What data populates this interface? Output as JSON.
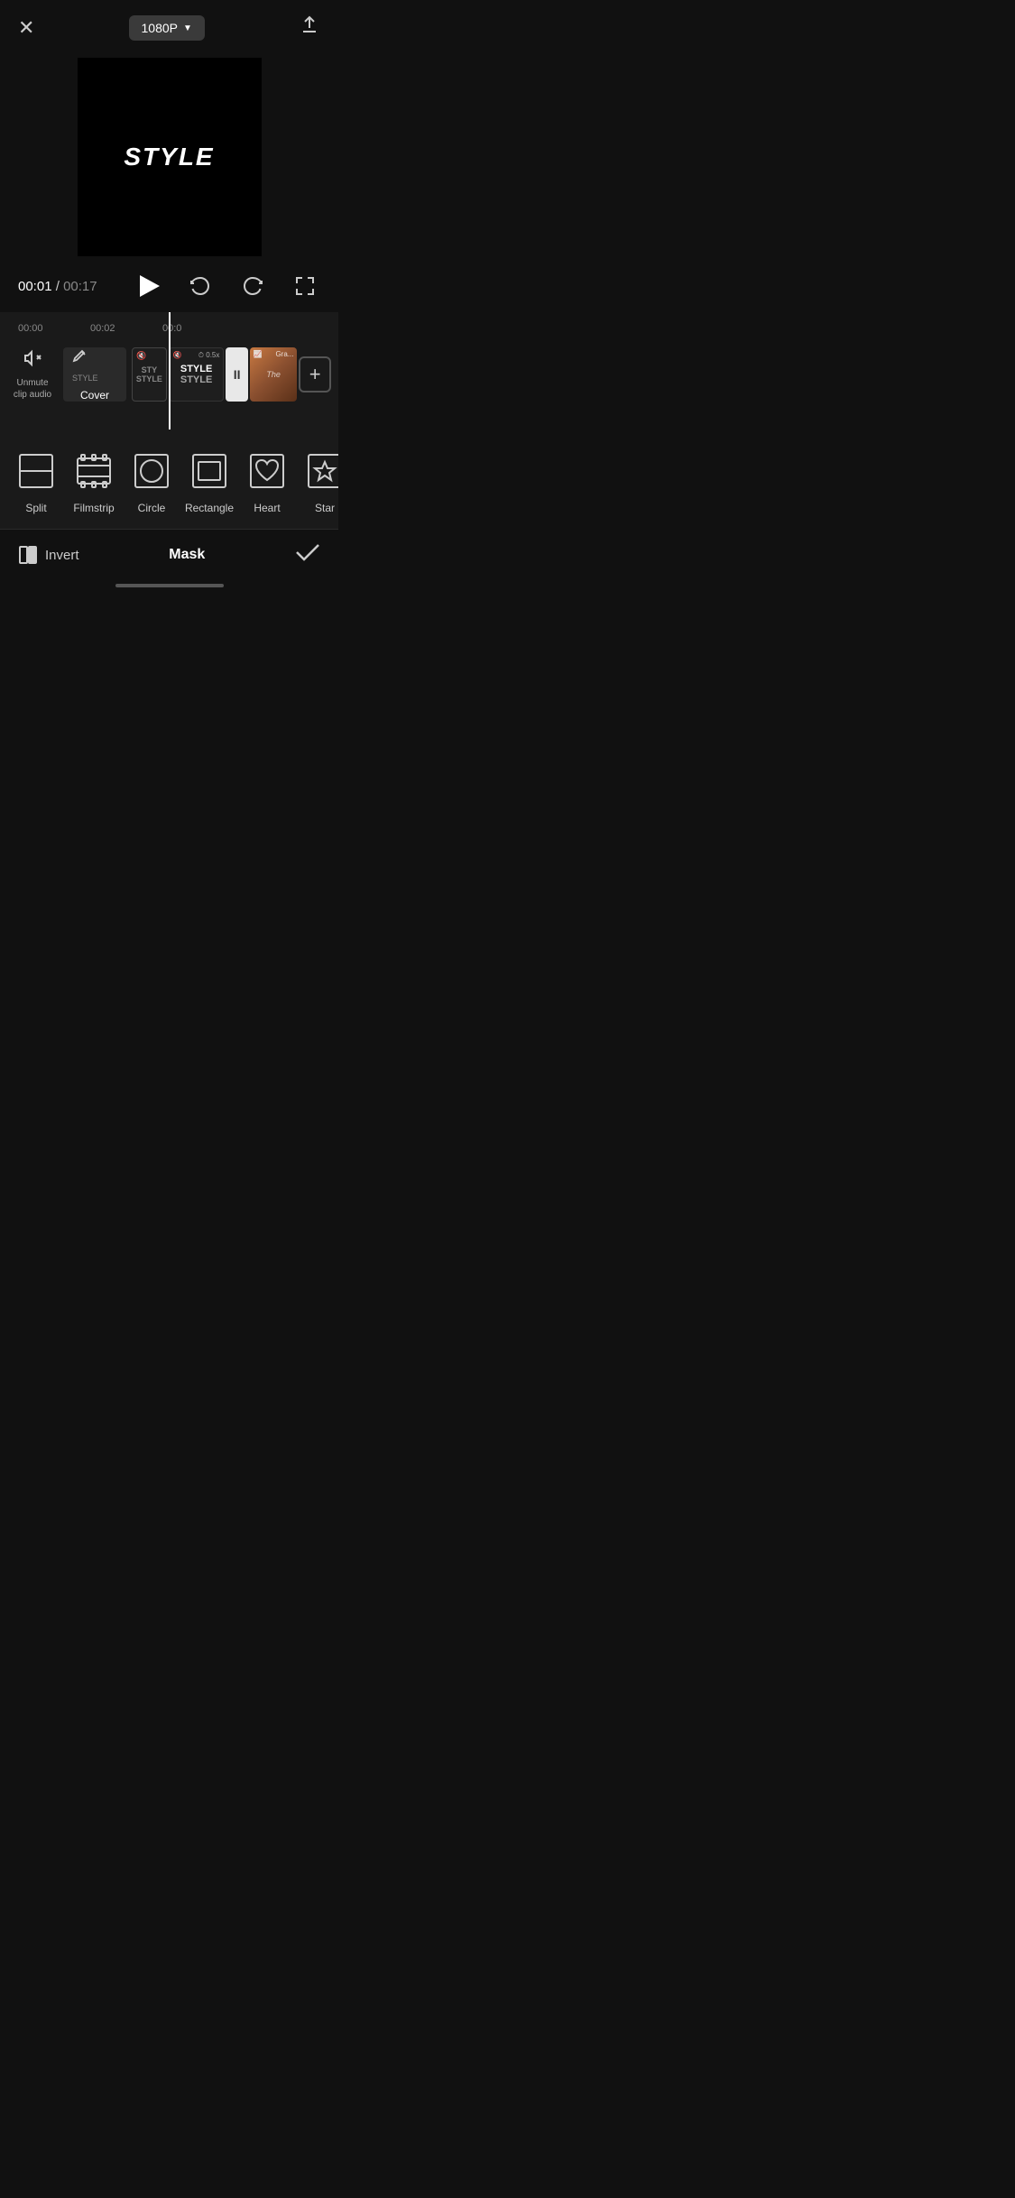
{
  "topBar": {
    "resolution": "1080P",
    "closeLabel": "✕",
    "exportLabel": "↑"
  },
  "videoPreview": {
    "styleText": "STYLE"
  },
  "playback": {
    "currentTime": "00:01",
    "separator": "/",
    "totalTime": "00:17"
  },
  "timeline": {
    "ruler": [
      "00:00",
      "00:02",
      "00:0"
    ],
    "trackAudio": {
      "iconLabel": "🔇",
      "label": "Unmute\nclip audio"
    },
    "trackCover": {
      "label": "Cover"
    }
  },
  "shapes": [
    {
      "id": "split",
      "name": "Split"
    },
    {
      "id": "filmstrip",
      "name": "Filmstrip"
    },
    {
      "id": "circle",
      "name": "Circle"
    },
    {
      "id": "rectangle",
      "name": "Rectangle"
    },
    {
      "id": "heart",
      "name": "Heart"
    },
    {
      "id": "star",
      "name": "Star"
    }
  ],
  "bottomBar": {
    "invertLabel": "Invert",
    "maskTitle": "Mask",
    "confirmLabel": "✓"
  }
}
